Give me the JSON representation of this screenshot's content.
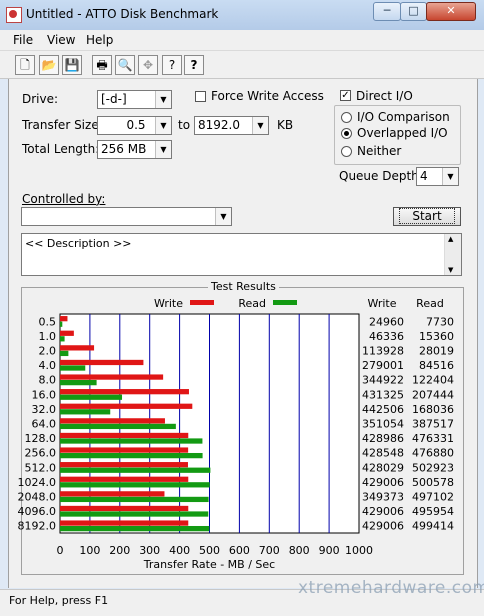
{
  "window": {
    "title": "Untitled - ATTO Disk Benchmark",
    "min": "─",
    "max": "□",
    "close": "✕"
  },
  "menu": [
    "File",
    "View",
    "Help"
  ],
  "toolbar": {
    "icons": [
      "new-icon",
      "open-icon",
      "save-icon",
      "print-icon",
      "print-preview-icon",
      "move-icon",
      "help-icon",
      "context-help-icon"
    ],
    "glyphs": [
      "🗋",
      "📂",
      "💾",
      "🖶",
      "🔍",
      "✥",
      "?",
      "?"
    ]
  },
  "form": {
    "drive_label": "Drive:",
    "drive_value": "[-d-]",
    "force_write_label": "Force Write Access",
    "force_write_checked": false,
    "direct_io_label": "Direct I/O",
    "direct_io_checked": true,
    "transfer_size_label": "Transfer Size:",
    "transfer_from": "0.5",
    "to_label": "to",
    "transfer_to": "8192.0",
    "kb_label": "KB",
    "total_length_label": "Total Length:",
    "total_length_value": "256 MB",
    "io_comparison_label": "I/O Comparison",
    "overlapped_io_label": "Overlapped I/O",
    "neither_label": "Neither",
    "io_mode_selected": "overlapped",
    "queue_depth_label": "Queue Depth:",
    "queue_depth_value": "4",
    "controlled_by_label": "Controlled by:",
    "controlled_by_value": "",
    "start_label": "Start",
    "description_text": "<< Description >>"
  },
  "results": {
    "title": "Test Results",
    "write_legend": "Write",
    "read_legend": "Read",
    "write_col": "Write",
    "read_col": "Read",
    "write_color": "#e01616",
    "read_color": "#139a13"
  },
  "chart_data": {
    "type": "bar",
    "orientation": "horizontal",
    "categories": [
      "0.5",
      "1.0",
      "2.0",
      "4.0",
      "8.0",
      "16.0",
      "32.0",
      "64.0",
      "128.0",
      "256.0",
      "512.0",
      "1024.0",
      "2048.0",
      "4096.0",
      "8192.0"
    ],
    "series": [
      {
        "name": "Write",
        "values": [
          24960,
          46336,
          113928,
          279001,
          344922,
          431325,
          442506,
          351054,
          428986,
          428548,
          428029,
          429006,
          349373,
          429006,
          429006
        ]
      },
      {
        "name": "Read",
        "values": [
          7730,
          15360,
          28019,
          84516,
          122404,
          207444,
          168036,
          387517,
          476331,
          476880,
          502923,
          500578,
          497102,
          495954,
          499414
        ]
      }
    ],
    "xticks": [
      "0",
      "100",
      "200",
      "300",
      "400",
      "500",
      "600",
      "700",
      "800",
      "900",
      "1000"
    ],
    "xlim": [
      0,
      1000
    ],
    "xlabel": "Transfer Rate - MB / Sec",
    "grid": true,
    "legend": "top"
  },
  "status": {
    "text": "For Help, press F1",
    "watermark": "xtremehardware.com"
  }
}
